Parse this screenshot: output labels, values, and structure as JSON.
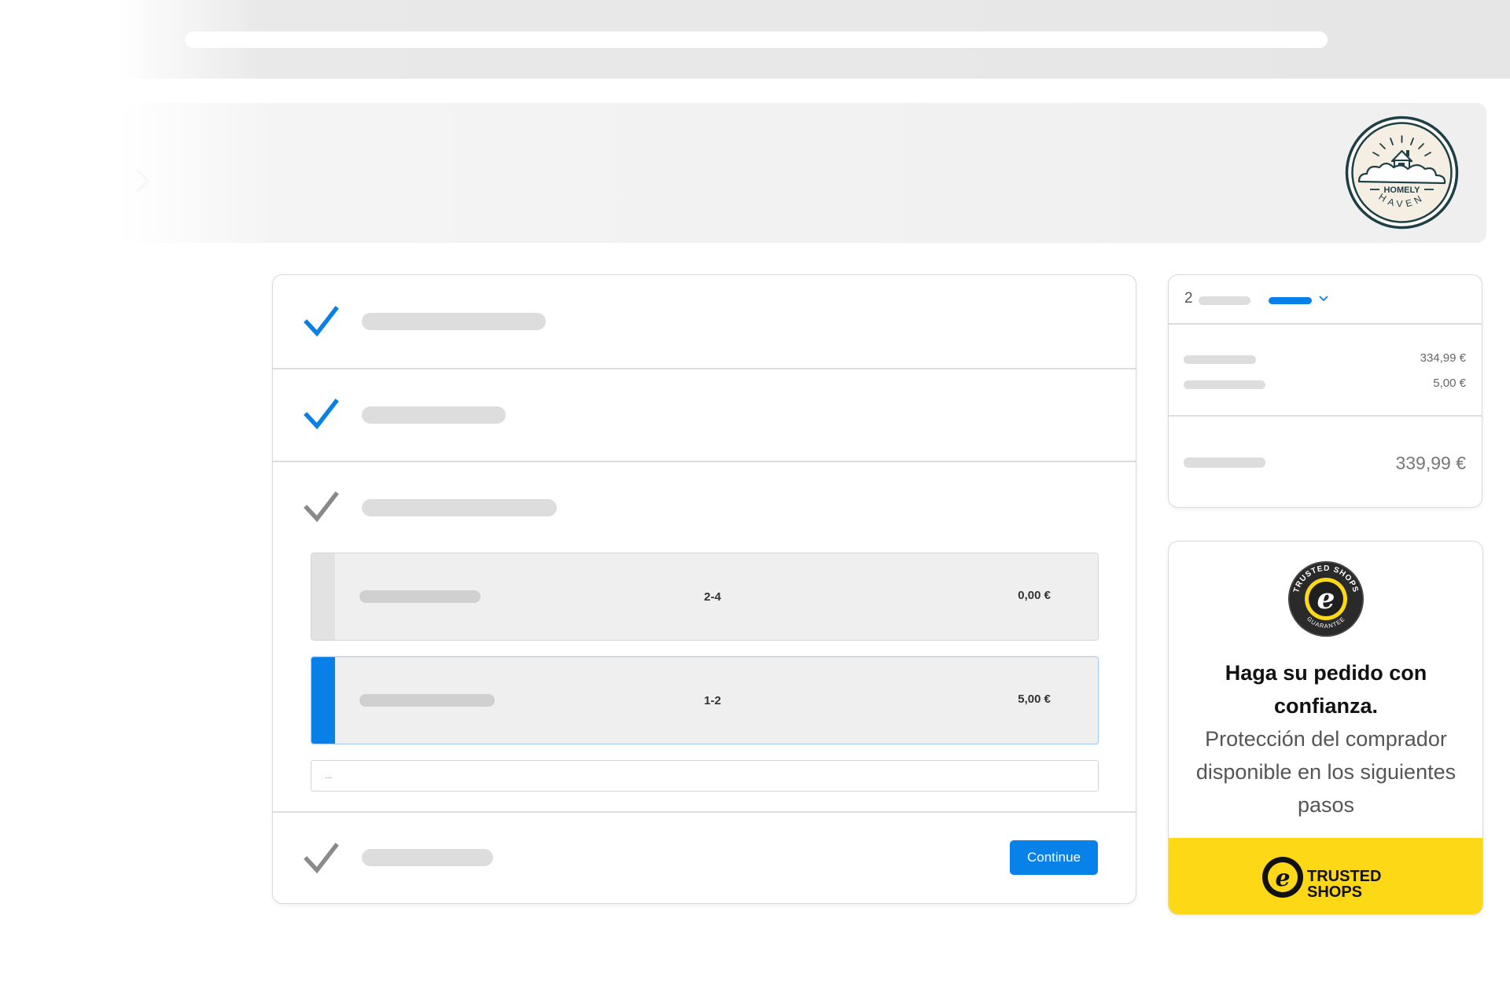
{
  "brand": {
    "line1": "HOMELY",
    "line2": "HAVEN",
    "colors": {
      "primary": "#0881e9",
      "logo_dark": "#1e3f45",
      "trust_yellow": "#fdd817"
    }
  },
  "checkout": {
    "steps": [
      {
        "state": "completed",
        "icon": "check-icon"
      },
      {
        "state": "completed",
        "icon": "check-icon"
      },
      {
        "state": "current",
        "icon": "check-icon"
      },
      {
        "state": "pending",
        "icon": "check-icon"
      }
    ],
    "shipping_options": [
      {
        "days": "2-4",
        "price": "0,00 €",
        "selected": false
      },
      {
        "days": "1-2",
        "price": "5,00 €",
        "selected": true
      }
    ],
    "comment_placeholder": "...",
    "continue_label": "Continue"
  },
  "summary": {
    "item_count": "2",
    "lines": [
      {
        "price": "334,99 €"
      },
      {
        "price": "5,00 €"
      }
    ],
    "total": "339,99 €"
  },
  "trust": {
    "badge_text_top": "TRUSTED SHOPS",
    "badge_text_bottom": "GUARANTEE",
    "heading": "Haga su pedido con confianza.",
    "text": "Protección del comprador disponible en los siguientes pasos",
    "logo_line1": "TRUSTED",
    "logo_line2": "SHOPS"
  }
}
